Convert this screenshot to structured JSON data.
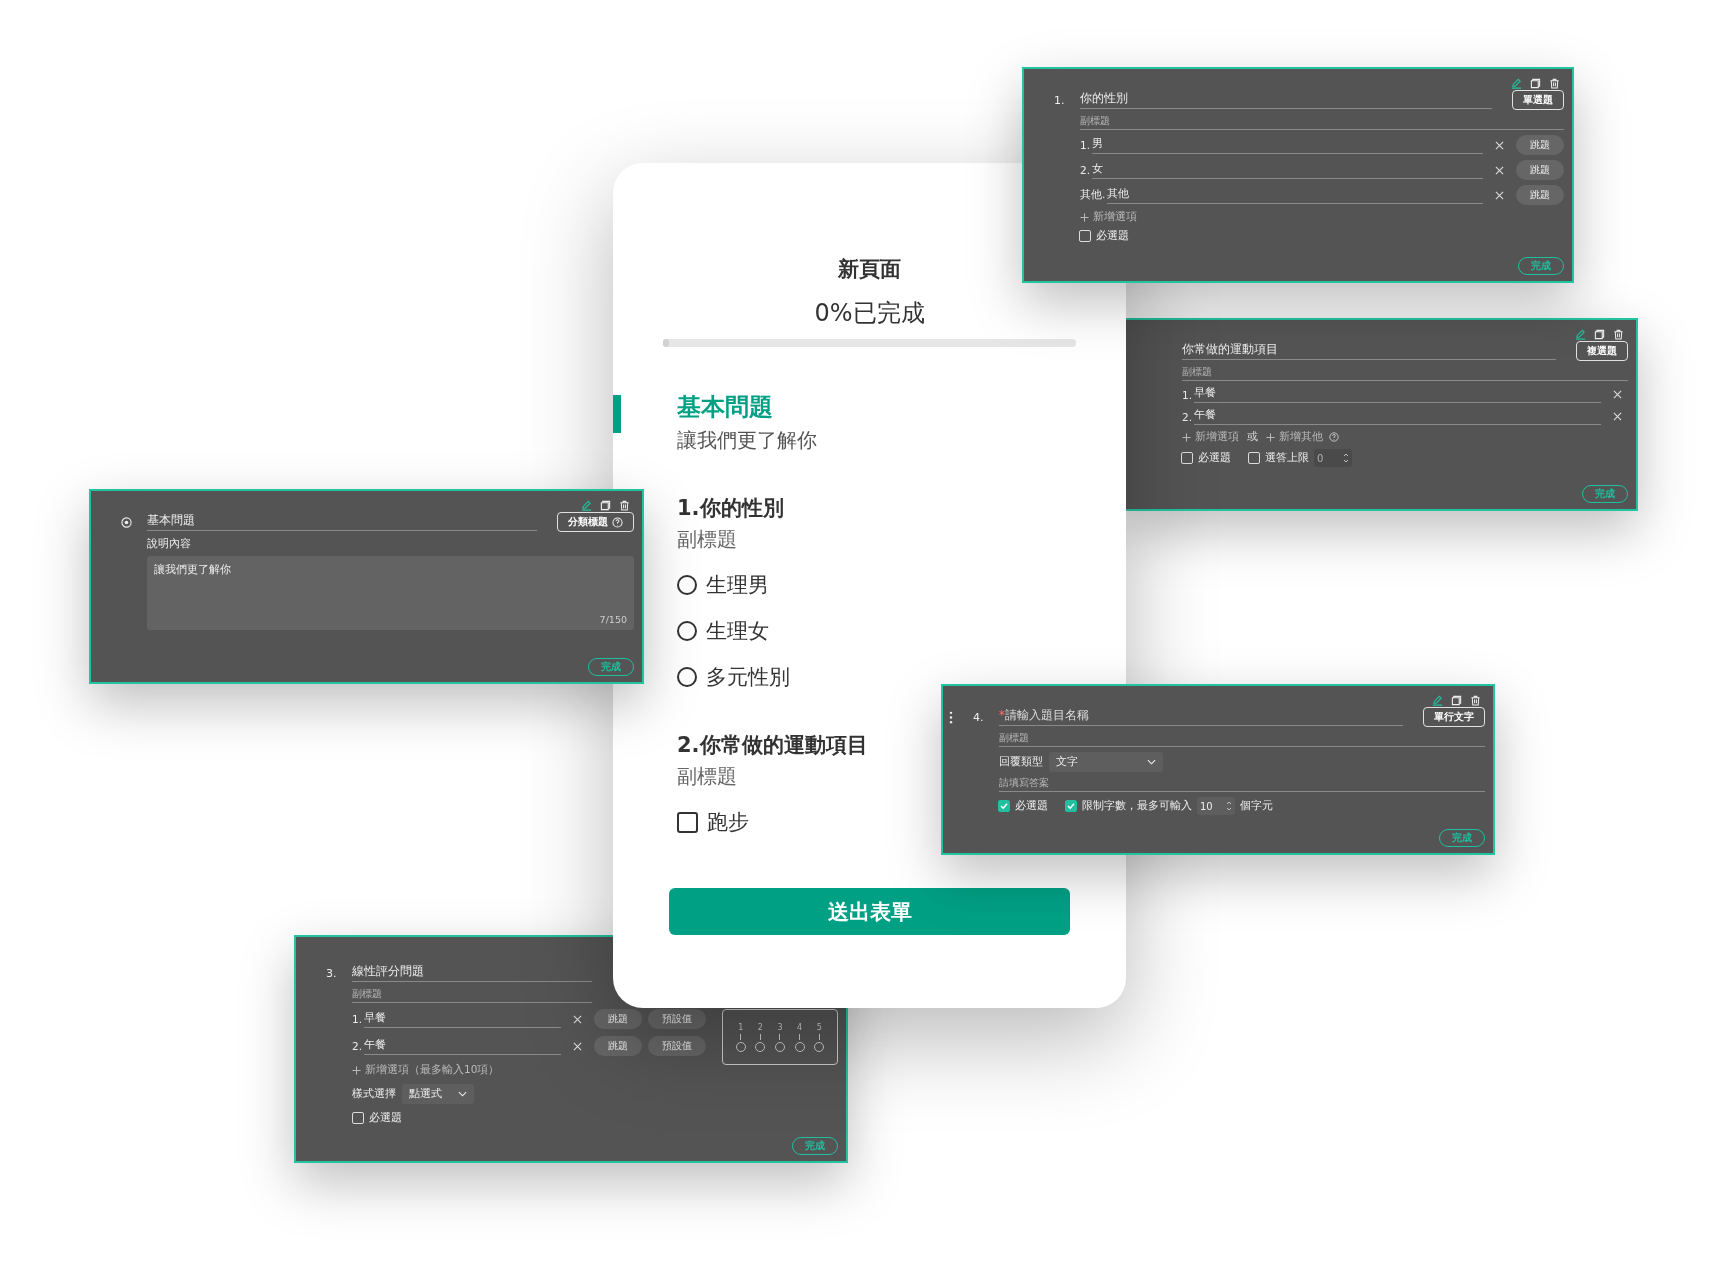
{
  "form_preview": {
    "page_title": "新頁面",
    "progress_text": "0%已完成",
    "progress": {
      "level": 0
    },
    "section": {
      "title": "基本問題",
      "description": "讓我們更了解你"
    },
    "questions": [
      {
        "kind": "radio",
        "title": "1.你的性別",
        "subtitle": "副標題",
        "options": [
          {
            "label": "生理男",
            "selected": false
          },
          {
            "label": "生理女",
            "selected": false
          },
          {
            "label": "多元性別",
            "selected": false
          }
        ]
      },
      {
        "kind": "checkbox",
        "title": "2.你常做的運動項目",
        "subtitle": "副標題",
        "options": [
          {
            "label": "跑步",
            "checked": false
          }
        ]
      }
    ],
    "submit_button": "送出表單"
  },
  "editor_panels": [
    {
      "kind": "single_choice",
      "number": "1.",
      "title": "你的性別",
      "type_button": "單選題",
      "subtitle_placeholder": "副標題",
      "options": [
        {
          "prefix": "1.",
          "label": "男",
          "jump_button": "跳題"
        },
        {
          "prefix": "2.",
          "label": "女",
          "jump_button": "跳題"
        },
        {
          "prefix": "其他.",
          "label": "其他",
          "jump_button": "跳題"
        }
      ],
      "add_option": "新增選項",
      "required": {
        "label": "必選題",
        "checked": false
      },
      "done_button": "完成"
    },
    {
      "kind": "multiple_choice",
      "title": "你常做的運動項目",
      "type_button": "複選題",
      "subtitle_placeholder": "副標題",
      "options": [
        {
          "prefix": "1.",
          "label": "早餐"
        },
        {
          "prefix": "2.",
          "label": "午餐"
        }
      ],
      "add_option": "新增選項",
      "or_text": "或",
      "add_other": "新增其他",
      "required": {
        "label": "必選題",
        "checked": false
      },
      "limit": {
        "label": "選答上限",
        "checked": false,
        "value": "0"
      },
      "done_button": "完成"
    },
    {
      "kind": "section",
      "title": "基本問題",
      "type_button": "分類標題",
      "description_label": "說明內容",
      "description": "讓我們更了解你",
      "counter": "7/150",
      "done_button": "完成"
    },
    {
      "kind": "text",
      "number": "4.",
      "required_mark": "*",
      "title_placeholder": "請輸入題目名稱",
      "type_button": "單行文字",
      "subtitle_placeholder": "副標題",
      "answer_type_label": "回覆類型",
      "answer_type": "文字",
      "answer_placeholder": "請填寫答案",
      "required": {
        "label": "必選題",
        "checked": true
      },
      "limit": {
        "label": "限制字數，最多可輸入",
        "checked": true,
        "value": "10",
        "unit": "個字元"
      },
      "done_button": "完成"
    },
    {
      "kind": "linear_scale",
      "number": "3.",
      "title": "線性評分問題",
      "subtitle_placeholder": "副標題",
      "options": [
        {
          "prefix": "1.",
          "label": "早餐",
          "jump_button": "跳題",
          "default_button": "預設值"
        },
        {
          "prefix": "2.",
          "label": "午餐",
          "jump_button": "跳題",
          "default_button": "預設值"
        }
      ],
      "add_option": "新增選項（最多輸入10項）",
      "style_label": "樣式選擇",
      "style_value": "點選式",
      "scale_labels": [
        "1",
        "2",
        "3",
        "4",
        "5"
      ],
      "required": {
        "label": "必選題",
        "checked": false
      },
      "done_button": "完成"
    }
  ]
}
